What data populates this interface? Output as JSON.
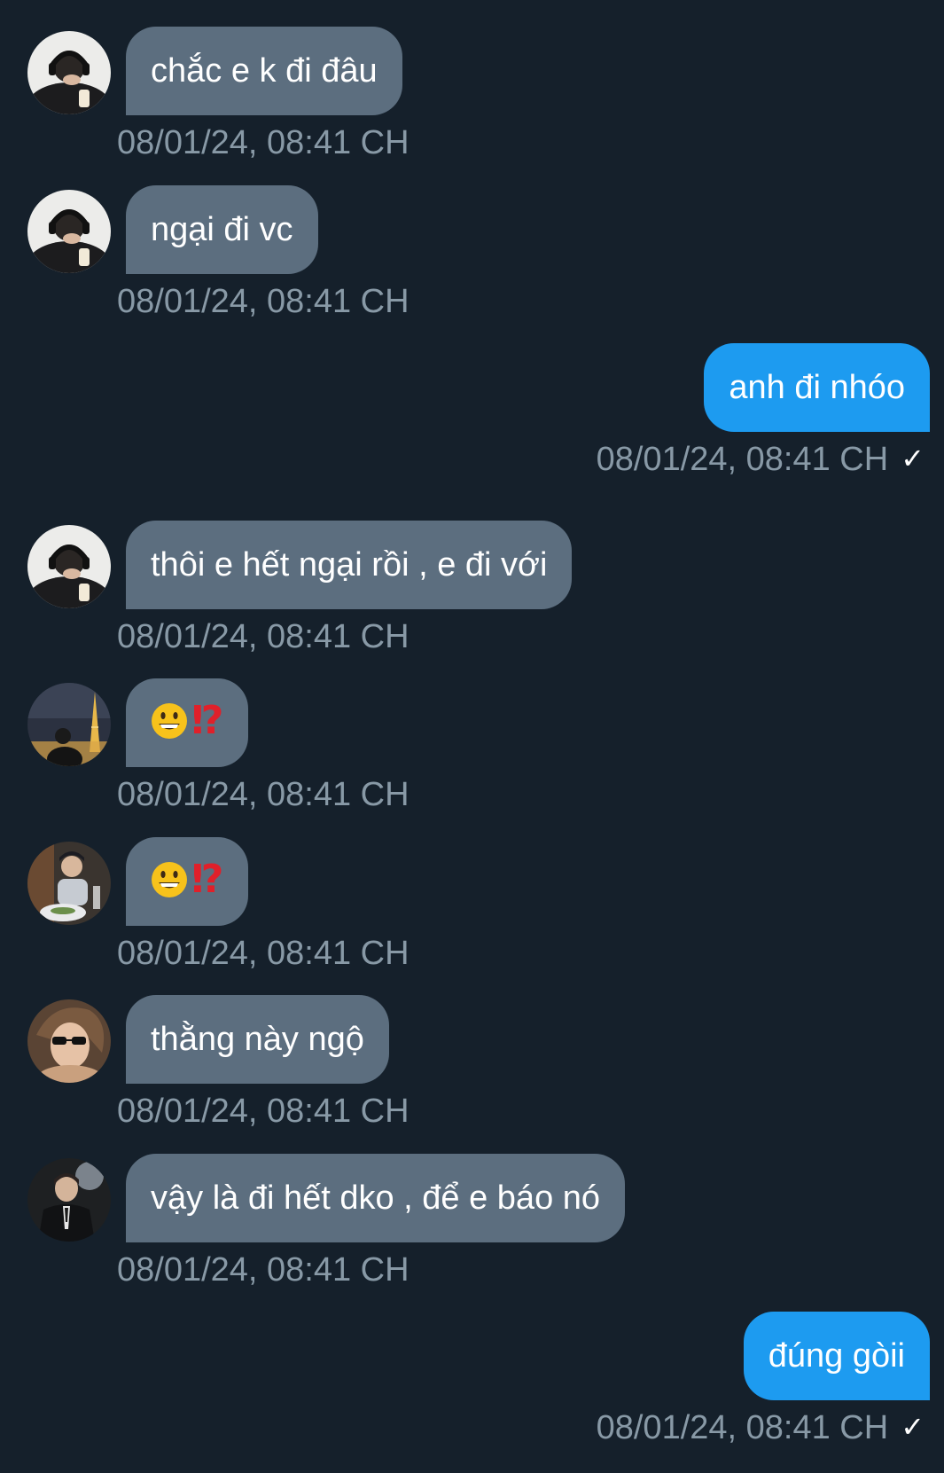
{
  "messages": [
    {
      "direction": "in",
      "avatar": "avatar-headphones",
      "text": "chắc e k đi đâu",
      "time": "08/01/24, 08:41 CH"
    },
    {
      "direction": "in",
      "avatar": "avatar-headphones",
      "text": "ngại đi vc",
      "time": "08/01/24, 08:41 CH"
    },
    {
      "direction": "out",
      "text": "anh đi nhóo",
      "time": "08/01/24, 08:41 CH",
      "status": "✓"
    },
    {
      "direction": "in",
      "avatar": "avatar-headphones",
      "text": "thôi e hết ngại rồi , e đi với",
      "time": "08/01/24, 08:41 CH"
    },
    {
      "direction": "in",
      "avatar": "avatar-eiffel-night",
      "emoji": "grinning-face",
      "mark": "⁉",
      "time": "08/01/24, 08:41 CH"
    },
    {
      "direction": "in",
      "avatar": "avatar-restaurant",
      "emoji": "grinning-face",
      "mark": "⁉",
      "time": "08/01/24, 08:41 CH"
    },
    {
      "direction": "in",
      "avatar": "avatar-sunglasses",
      "text": "thằng này ngộ",
      "time": "08/01/24, 08:41 CH"
    },
    {
      "direction": "in",
      "avatar": "avatar-suit",
      "text": "vậy là đi hết dko , để e báo nó",
      "time": "08/01/24, 08:41 CH"
    },
    {
      "direction": "out",
      "text": "đúng gòii",
      "time": "08/01/24, 08:41 CH",
      "status": "✓"
    }
  ],
  "colors": {
    "background": "#15202b",
    "incoming_bubble": "#5c6e7f",
    "outgoing_bubble": "#1d9bf0",
    "timestamp": "#8899a6",
    "emoji_mark": "#e0202a"
  }
}
